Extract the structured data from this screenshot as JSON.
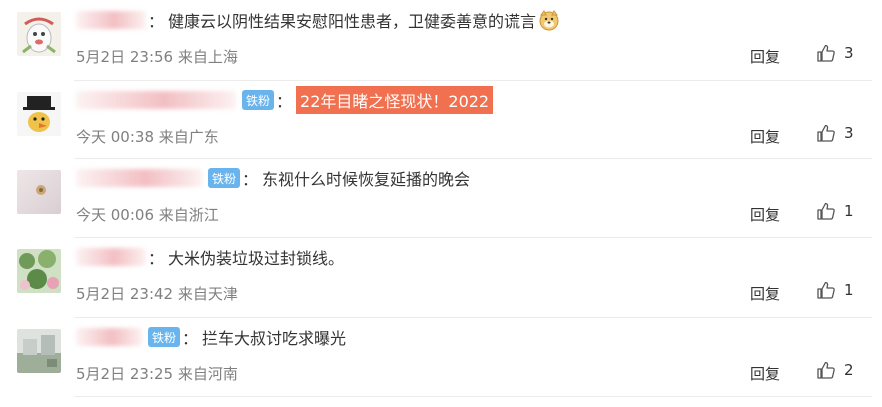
{
  "comments": [
    {
      "badge": "",
      "text": "健康云以阴性结果安慰阳性患者，卫健委善意的谎言",
      "highlight": false,
      "emoji": "doge-icon",
      "time": "5月2日 23:56",
      "location": "来自上海",
      "reply_label": "回复",
      "likes": "3"
    },
    {
      "badge": "铁粉",
      "text": "22年目睹之怪现状！2022",
      "highlight": true,
      "emoji": "",
      "time": "今天 00:38",
      "location": "来自广东",
      "reply_label": "回复",
      "likes": "3"
    },
    {
      "badge": "铁粉",
      "text": "东视什么时候恢复延播的晚会",
      "highlight": false,
      "emoji": "",
      "time": "今天 00:06",
      "location": "来自浙江",
      "reply_label": "回复",
      "likes": "1"
    },
    {
      "badge": "",
      "text": "大米伪装垃圾过封锁线。",
      "highlight": false,
      "emoji": "",
      "time": "5月2日 23:42",
      "location": "来自天津",
      "reply_label": "回复",
      "likes": "1"
    },
    {
      "badge": "铁粉",
      "text": "拦车大叔讨吃求曝光",
      "highlight": false,
      "emoji": "",
      "time": "5月2日 23:25",
      "location": "来自河南",
      "reply_label": "回复",
      "likes": "2"
    }
  ],
  "colors": {
    "badge": "#6ab4ee",
    "highlight": "#f0704f",
    "meta": "#808080",
    "divider": "#ececec"
  }
}
